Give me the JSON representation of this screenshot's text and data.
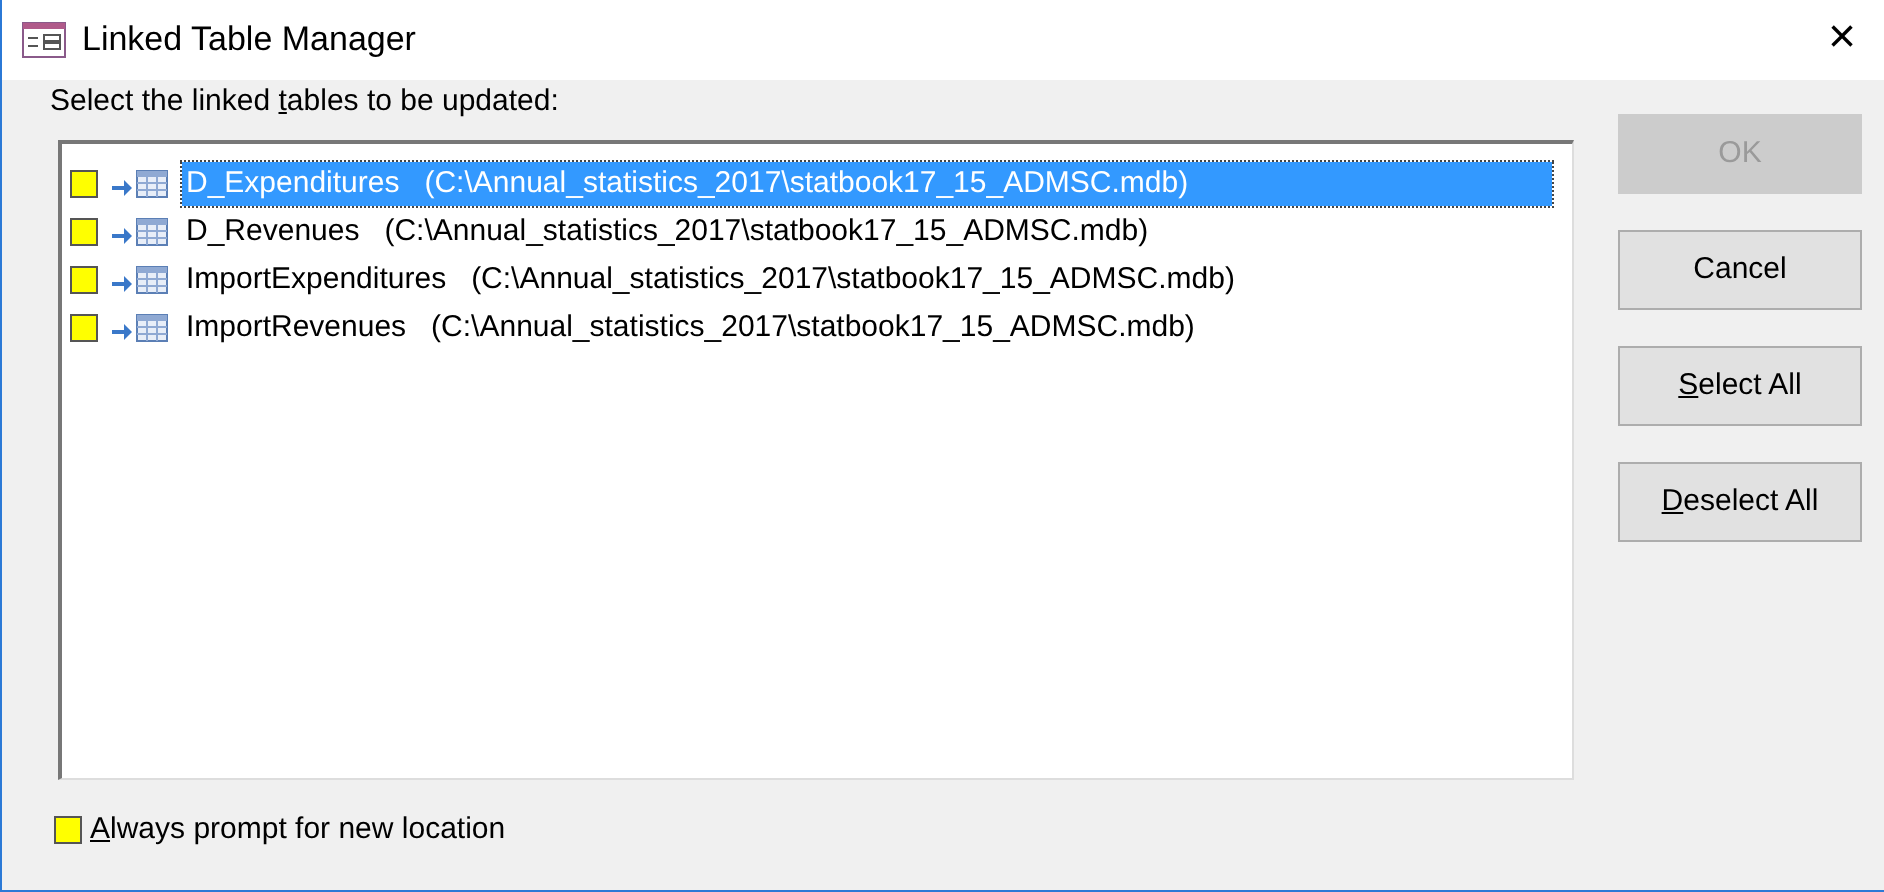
{
  "window": {
    "title": "Linked Table Manager",
    "close": "×"
  },
  "instruction": {
    "before": "Select the linked ",
    "access_key": "t",
    "after": "ables to be updated:"
  },
  "tables": [
    {
      "name": "D_Expenditures",
      "path": "(C:\\Annual_statistics_2017\\statbook17_15_ADMSC.mdb)",
      "checked": false,
      "selected": true
    },
    {
      "name": "D_Revenues",
      "path": "(C:\\Annual_statistics_2017\\statbook17_15_ADMSC.mdb)",
      "checked": false,
      "selected": false
    },
    {
      "name": "ImportExpenditures",
      "path": "(C:\\Annual_statistics_2017\\statbook17_15_ADMSC.mdb)",
      "checked": false,
      "selected": false
    },
    {
      "name": "ImportRevenues",
      "path": "(C:\\Annual_statistics_2017\\statbook17_15_ADMSC.mdb)",
      "checked": false,
      "selected": false
    }
  ],
  "buttons": [
    {
      "after": "OK",
      "disabled": true
    },
    {
      "after": "Cancel",
      "disabled": false
    },
    {
      "access_key": "S",
      "after": "elect All",
      "disabled": false
    },
    {
      "access_key": "D",
      "after": "eselect All",
      "disabled": false
    }
  ],
  "always_prompt": {
    "access_key": "A",
    "after": "lways prompt for new location",
    "checked": false
  }
}
